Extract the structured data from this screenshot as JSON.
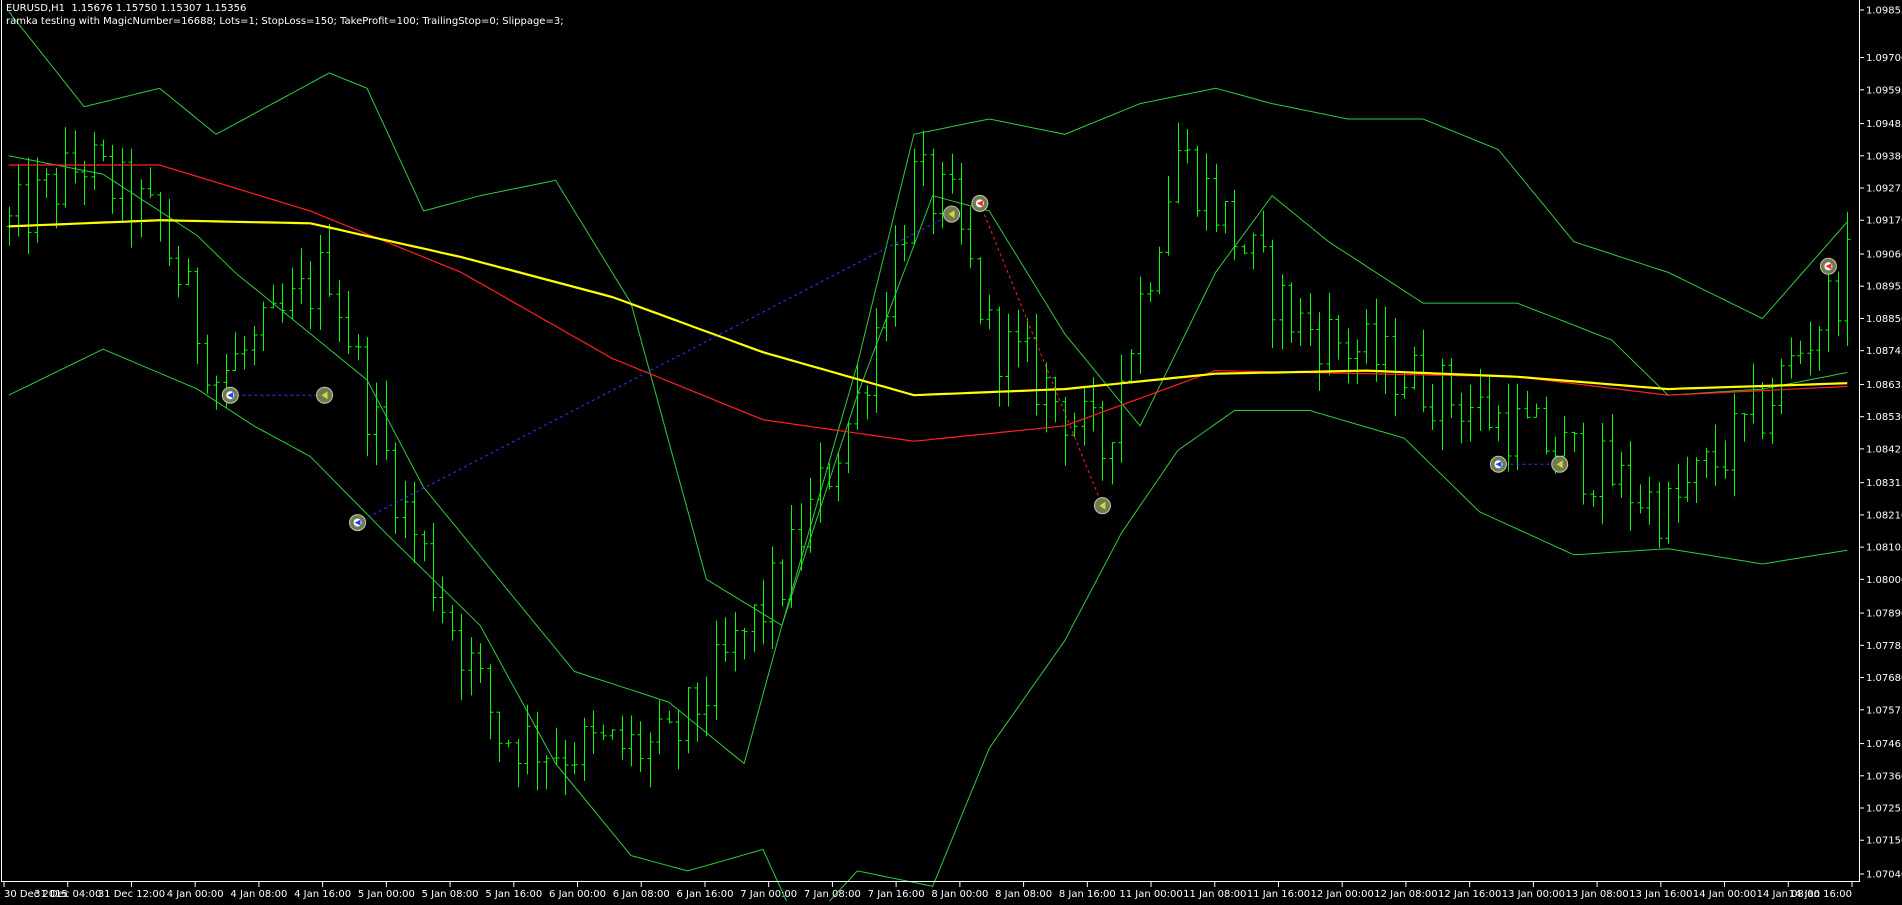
{
  "header": {
    "symbol_line": "EURUSD,H1  1.15676 1.15750 1.15307 1.15356",
    "ea_line": "ramka testing with MagicNumber=16688; Lots=1; StopLoss=150; TakeProfit=100; TrailingStop=0; Slippage=3;"
  },
  "colors": {
    "background": "#000000",
    "bars": "#00ff00",
    "bollinger": "#2ecc40",
    "ma_fast": "#ff2020",
    "ma_slow": "#ffff00",
    "buy_link": "#3333ff",
    "sell_link": "#ff2020",
    "axis": "#ffffff"
  },
  "chart_data": {
    "type": "line",
    "symbol": "EURUSD",
    "timeframe": "H1",
    "ylim": [
      1.0704,
      1.09855
    ],
    "y_ticks": [
      "1.09855",
      "1.09700",
      "1.09595",
      "1.09485",
      "1.09380",
      "1.09275",
      "1.09170",
      "1.09060",
      "1.08955",
      "1.08850",
      "1.08745",
      "1.08635",
      "1.08530",
      "1.08425",
      "1.08315",
      "1.08210",
      "1.08105",
      "1.08000",
      "1.07890",
      "1.07785",
      "1.07680",
      "1.07575",
      "1.07465",
      "1.07360",
      "1.07255",
      "1.07150",
      "1.07040"
    ],
    "x_ticks": [
      "30 Dec 2015",
      "31 Dec 04:00",
      "31 Dec 12:00",
      "4 Jan 00:00",
      "4 Jan 08:00",
      "4 Jan 16:00",
      "5 Jan 00:00",
      "5 Jan 08:00",
      "5 Jan 16:00",
      "6 Jan 00:00",
      "6 Jan 08:00",
      "6 Jan 16:00",
      "7 Jan 00:00",
      "7 Jan 08:00",
      "7 Jan 16:00",
      "8 Jan 00:00",
      "8 Jan 08:00",
      "8 Jan 16:00",
      "11 Jan 00:00",
      "11 Jan 08:00",
      "11 Jan 16:00",
      "12 Jan 00:00",
      "12 Jan 08:00",
      "12 Jan 16:00",
      "13 Jan 00:00",
      "13 Jan 08:00",
      "13 Jan 16:00",
      "14 Jan 00:00",
      "14 Jan 08:00",
      "14 Jan 16:00"
    ],
    "grid": false,
    "bars_count": 196,
    "price_anchors": {
      "bar_index": [
        0,
        8,
        16,
        22,
        28,
        34,
        38,
        42,
        52,
        58,
        70,
        82,
        90,
        96,
        100,
        104,
        110,
        116,
        124,
        136,
        146,
        158,
        166,
        176,
        186,
        196
      ],
      "price": [
        1.0915,
        1.0936,
        1.0915,
        1.0866,
        1.0881,
        1.0902,
        1.0858,
        1.0822,
        1.075,
        1.0745,
        1.0745,
        1.08,
        1.0858,
        1.093,
        1.092,
        1.088,
        1.0862,
        1.0842,
        1.094,
        1.0885,
        1.087,
        1.0852,
        1.084,
        1.0822,
        1.0855,
        1.0905
      ]
    },
    "series": [
      {
        "name": "Bollinger upper",
        "x": [
          0,
          8,
          16,
          22,
          28,
          34,
          38,
          44,
          50,
          58,
          66,
          74,
          82,
          90,
          96,
          104,
          112,
          120,
          128,
          134,
          142,
          150,
          158,
          166,
          176,
          186,
          196
        ],
        "values": [
          1.0985,
          1.0954,
          1.096,
          1.0945,
          1.0955,
          1.0965,
          1.096,
          1.092,
          1.0925,
          1.093,
          1.089,
          1.08,
          1.0785,
          1.087,
          1.0945,
          1.095,
          1.0945,
          1.0955,
          1.096,
          1.0955,
          1.095,
          1.095,
          1.094,
          1.091,
          1.09,
          1.0885,
          1.092
        ]
      },
      {
        "name": "Bollinger middle",
        "x": [
          0,
          10,
          20,
          24,
          32,
          38,
          44,
          52,
          60,
          70,
          78,
          82,
          90,
          98,
          104,
          112,
          120,
          128,
          134,
          140,
          150,
          160,
          170,
          176,
          186,
          196
        ],
        "values": [
          1.0938,
          1.0932,
          1.0912,
          1.09,
          1.088,
          1.0865,
          1.083,
          1.08,
          1.077,
          1.076,
          1.074,
          1.0785,
          1.086,
          1.0925,
          1.092,
          1.088,
          1.085,
          1.09,
          1.0925,
          1.091,
          1.089,
          1.089,
          1.0878,
          1.086,
          1.0862,
          1.0868
        ]
      },
      {
        "name": "Bollinger lower",
        "x": [
          0,
          10,
          20,
          26,
          32,
          40,
          50,
          58,
          66,
          72,
          80,
          84,
          90,
          98,
          104,
          112,
          118,
          124,
          130,
          138,
          148,
          156,
          166,
          176,
          186,
          196
        ],
        "values": [
          1.086,
          1.0875,
          1.0862,
          1.085,
          1.084,
          1.0815,
          1.0785,
          1.074,
          1.071,
          1.0705,
          1.0712,
          1.0685,
          1.0705,
          1.07,
          1.0745,
          1.078,
          1.0815,
          1.0842,
          1.0855,
          1.0855,
          1.0846,
          1.0822,
          1.0808,
          1.081,
          1.0805,
          1.081
        ]
      },
      {
        "name": "MA fast",
        "x": [
          0,
          16,
          32,
          48,
          64,
          80,
          96,
          112,
          128,
          144,
          160,
          176,
          196
        ],
        "values": [
          1.0935,
          1.0935,
          1.092,
          1.09,
          1.0872,
          1.0852,
          1.0845,
          1.085,
          1.0868,
          1.0867,
          1.0866,
          1.086,
          1.0863
        ]
      },
      {
        "name": "MA slow",
        "x": [
          0,
          16,
          32,
          48,
          64,
          80,
          96,
          112,
          128,
          144,
          160,
          176,
          196
        ],
        "values": [
          1.0915,
          1.0917,
          1.0916,
          1.0905,
          1.0892,
          1.0874,
          1.086,
          1.0862,
          1.0867,
          1.0868,
          1.0866,
          1.0862,
          1.0864
        ]
      }
    ],
    "trades": [
      {
        "kind": "buy",
        "open_x": 23.5,
        "open_price": 1.086,
        "close_x": 33.5,
        "close_price": 1.086
      },
      {
        "kind": "buy",
        "open_x": 37,
        "open_price": 1.08185,
        "close_x": 100,
        "close_price": 1.0919
      },
      {
        "kind": "sell",
        "open_x": 103,
        "open_price": 1.09225,
        "close_x": 116,
        "close_price": 1.0824
      },
      {
        "kind": "buy",
        "open_x": 158,
        "open_price": 1.08375,
        "close_x": 164.5,
        "close_price": 1.08375
      },
      {
        "kind": "sell",
        "open_x": 193,
        "open_price": 1.0902,
        "close_x": null,
        "close_price": null
      }
    ]
  }
}
